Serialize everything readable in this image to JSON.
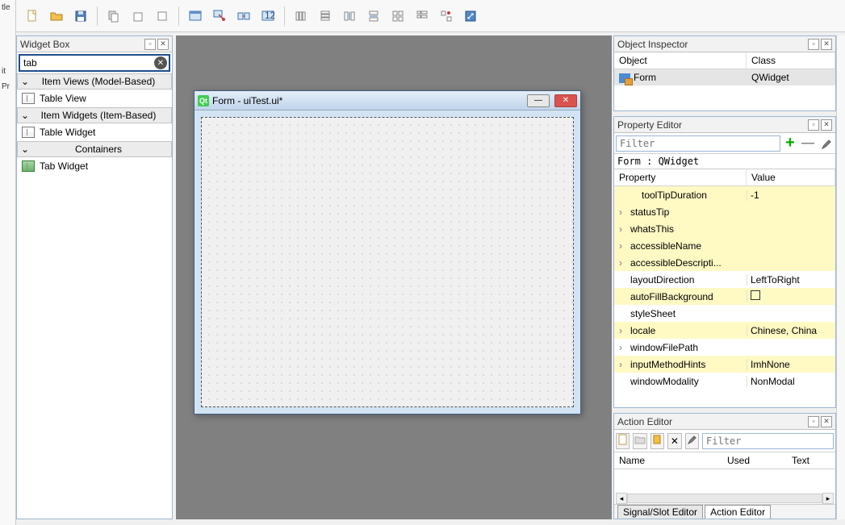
{
  "toolbar": {
    "buttons": [
      "new",
      "open",
      "save",
      "copy",
      "paste",
      "cut",
      "edit-widgets",
      "signals-slots",
      "buddies",
      "tab-order",
      "layout-h",
      "layout-v",
      "layout-hsplit",
      "layout-vsplit",
      "layout-grid",
      "layout-form",
      "break-layout",
      "adjust-size"
    ]
  },
  "widget_box": {
    "title": "Widget Box",
    "search_value": "tab",
    "categories": [
      {
        "label": "Item Views (Model-Based)",
        "items": [
          {
            "name": "Table View",
            "icon": "table"
          }
        ]
      },
      {
        "label": "Item Widgets (Item-Based)",
        "items": [
          {
            "name": "Table Widget",
            "icon": "table"
          }
        ]
      },
      {
        "label": "Containers",
        "items": [
          {
            "name": "Tab Widget",
            "icon": "tab"
          }
        ]
      }
    ]
  },
  "canvas": {
    "window_title": "Form - uiTest.ui*"
  },
  "object_inspector": {
    "title": "Object Inspector",
    "columns": [
      "Object",
      "Class"
    ],
    "rows": [
      {
        "object": "Form",
        "class": "QWidget"
      }
    ]
  },
  "property_editor": {
    "title": "Property Editor",
    "filter_placeholder": "Filter",
    "context": "Form : QWidget",
    "columns": [
      "Property",
      "Value"
    ],
    "rows": [
      {
        "name": "toolTipDuration",
        "value": "-1",
        "exp": "",
        "color": "yellow",
        "indent": true
      },
      {
        "name": "statusTip",
        "value": "",
        "exp": "›",
        "color": "yellow"
      },
      {
        "name": "whatsThis",
        "value": "",
        "exp": "›",
        "color": "yellow"
      },
      {
        "name": "accessibleName",
        "value": "",
        "exp": "›",
        "color": "yellow"
      },
      {
        "name": "accessibleDescripti...",
        "value": "",
        "exp": "›",
        "color": "yellow"
      },
      {
        "name": "layoutDirection",
        "value": "LeftToRight",
        "exp": "",
        "color": "white"
      },
      {
        "name": "autoFillBackground",
        "value": "[checkbox]",
        "exp": "",
        "color": "yellow"
      },
      {
        "name": "styleSheet",
        "value": "",
        "exp": "",
        "color": "white"
      },
      {
        "name": "locale",
        "value": "Chinese, China",
        "exp": "›",
        "color": "yellow"
      },
      {
        "name": "windowFilePath",
        "value": "",
        "exp": "›",
        "color": "white"
      },
      {
        "name": "inputMethodHints",
        "value": "ImhNone",
        "exp": "›",
        "color": "yellow"
      },
      {
        "name": "windowModality",
        "value": "NonModal",
        "exp": "",
        "color": "white"
      }
    ]
  },
  "action_editor": {
    "title": "Action Editor",
    "filter_placeholder": "Filter",
    "columns": [
      "Name",
      "Used",
      "Text"
    ],
    "tabs": [
      "Signal/Slot Editor",
      "Action Editor"
    ]
  }
}
